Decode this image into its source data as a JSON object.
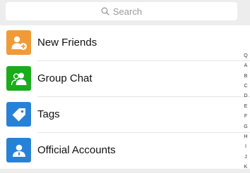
{
  "search": {
    "placeholder": "Search"
  },
  "list": {
    "items": [
      {
        "label": "New Friends",
        "icon": "add-friend-icon",
        "color": "#f19a37"
      },
      {
        "label": "Group Chat",
        "icon": "group-icon",
        "color": "#1aad19"
      },
      {
        "label": "Tags",
        "icon": "tag-icon",
        "color": "#2782d7"
      },
      {
        "label": "Official Accounts",
        "icon": "official-account-icon",
        "color": "#2782d7"
      }
    ]
  },
  "index": [
    "Q",
    "A",
    "B",
    "C",
    "D",
    "E",
    "F",
    "G",
    "H",
    "I",
    "J",
    "K"
  ]
}
